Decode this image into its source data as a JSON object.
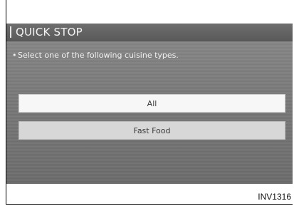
{
  "screen": {
    "title": "QUICK STOP",
    "instruction_bullet": "•",
    "instruction": "Select one of the following cuisine types."
  },
  "options": [
    {
      "label": "All"
    },
    {
      "label": "Fast Food"
    }
  ],
  "figure_code": "INV1316",
  "colors": {
    "screen_background": "#7a7a7a",
    "title_bar": "#5f5f5f",
    "title_text": "#f3f3f3",
    "option_selected": "#f7f7f7",
    "option_unselected": "#d7d7d7"
  }
}
